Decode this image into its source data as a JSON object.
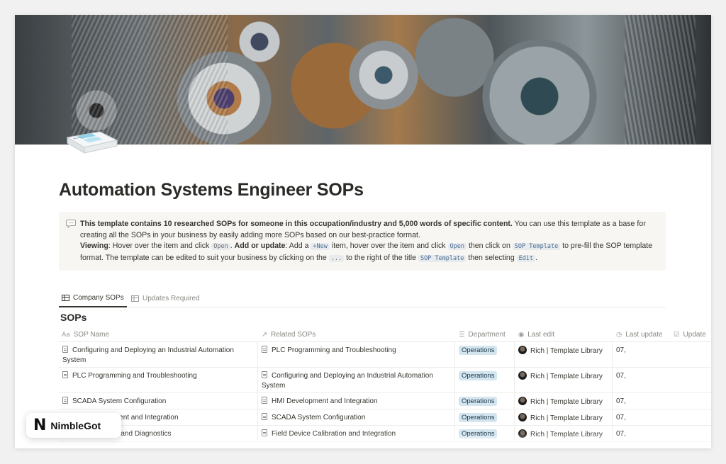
{
  "page": {
    "title": "Automation Systems Engineer SOPs"
  },
  "callout": {
    "icon": "speech-bubble-icon",
    "bold_intro": "This template contains 10 researched SOPs for someone in this occupation/industry and 5,000 words of specific content.",
    "intro_rest": " You can use this template as a base for creating all the SOPs in your business by easily adding more SOPs based on our best-practice format.",
    "viewing_label": "Viewing",
    "viewing_text": ": Hover over the item and click ",
    "open_code": "Open",
    "add_label": "Add or update",
    "add_text_1": ": Add a ",
    "new_code": "+New",
    "add_text_2": " item, hover over the item and click ",
    "open_code_2": "Open",
    "add_text_3": " then click on ",
    "sop_template_code": "SOP Template",
    "add_text_4": " to pre-fill the SOP template format. The template can be edited to suit your business by clicking on the ",
    "dots_code": "...",
    "add_text_5": " to the right of the title ",
    "sop_template_code_2": "SOP Template",
    "add_text_6": " then selecting ",
    "edit_code": "Edit",
    "add_text_7": "."
  },
  "tabs": [
    {
      "label": "Company SOPs",
      "icon": "table-icon",
      "active": true
    },
    {
      "label": "Updates Required",
      "icon": "table-icon",
      "active": false
    }
  ],
  "section_title": "SOPs",
  "table": {
    "columns": [
      {
        "label": "SOP Name",
        "icon": "Aa"
      },
      {
        "label": "Related SOPs",
        "icon": "↗"
      },
      {
        "label": "Department",
        "icon": "☰"
      },
      {
        "label": "Last edit",
        "icon": "◉"
      },
      {
        "label": "Last update",
        "icon": "◷"
      },
      {
        "label": "Update",
        "icon": "☑"
      }
    ],
    "rows": [
      {
        "name": "Configuring and Deploying an Industrial Automation System",
        "related": "PLC Programming and Troubleshooting",
        "department": "Operations",
        "editor": "Rich | Template Library",
        "date": "07,"
      },
      {
        "name": "PLC Programming and Troubleshooting",
        "related": "Configuring and Deploying an Industrial Automation System",
        "department": "Operations",
        "editor": "Rich | Template Library",
        "date": "07,"
      },
      {
        "name": "SCADA System Configuration",
        "related": "HMI Development and Integration",
        "department": "Operations",
        "editor": "Rich | Template Library",
        "date": "07,"
      },
      {
        "name": "HMI Development and Integration",
        "related": "SCADA System Configuration",
        "department": "Operations",
        "editor": "Rich | Template Library",
        "date": "07,"
      },
      {
        "name": "Network Setup and Diagnostics",
        "related": "Field Device Calibration and Integration",
        "department": "Operations",
        "editor": "Rich | Template Library",
        "date": "07,"
      }
    ]
  },
  "watermark": {
    "logo_letter": "N",
    "brand": "NimbleGot"
  },
  "colors": {
    "department_tag_bg": "#d3e5ef",
    "code_text": "#4c6d93",
    "callout_bg": "#f7f6f3"
  }
}
